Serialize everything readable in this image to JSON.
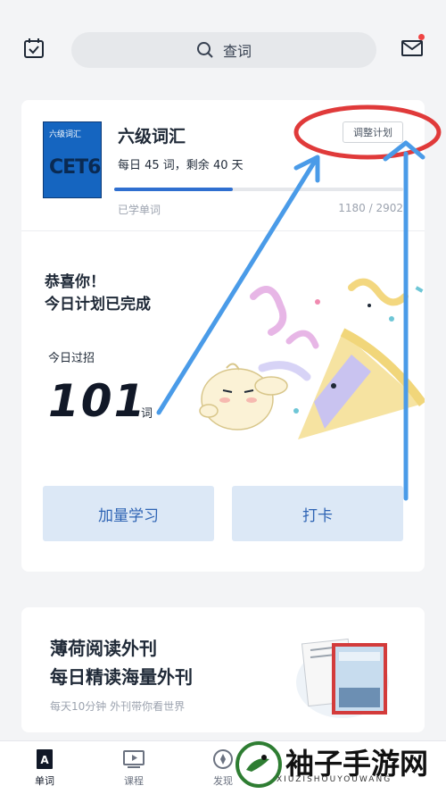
{
  "search": {
    "label": "查词"
  },
  "plan": {
    "cover_title": "六级词汇",
    "cover_big": "CET6",
    "title": "六级词汇",
    "daily_info": "每日 45 词，剩余 40 天",
    "adjust_button": "调整计划",
    "progress": 0.41,
    "learned_label": "已学单词",
    "learned_count": "1180 / 2902"
  },
  "today": {
    "congrats": "恭喜你！今日计划已完成",
    "congrats_line1": "恭喜你！",
    "congrats_line2": "今日计划已完成",
    "label": "今日过招",
    "count": "101",
    "unit": "词"
  },
  "actions": {
    "more": "加量学习",
    "checkin": "打卡"
  },
  "promo": {
    "line1": "薄荷阅读外刊",
    "line2": "每日精读海量外刊",
    "subtitle": "每天10分钟 外刊带你看世界"
  },
  "tabs": [
    {
      "label": "单词",
      "icon": "book-icon",
      "active": true
    },
    {
      "label": "课程",
      "icon": "video-icon",
      "active": false
    },
    {
      "label": "发现",
      "icon": "compass-icon",
      "active": false
    }
  ],
  "watermark": {
    "cn": "袖子手游网",
    "en": "XIUZISHOUYOUWANG"
  },
  "colors": {
    "accent": "#2f6fd0",
    "button_bg": "#dce8f6",
    "annotation": "#4a9be8",
    "circle": "#e03a3a"
  }
}
